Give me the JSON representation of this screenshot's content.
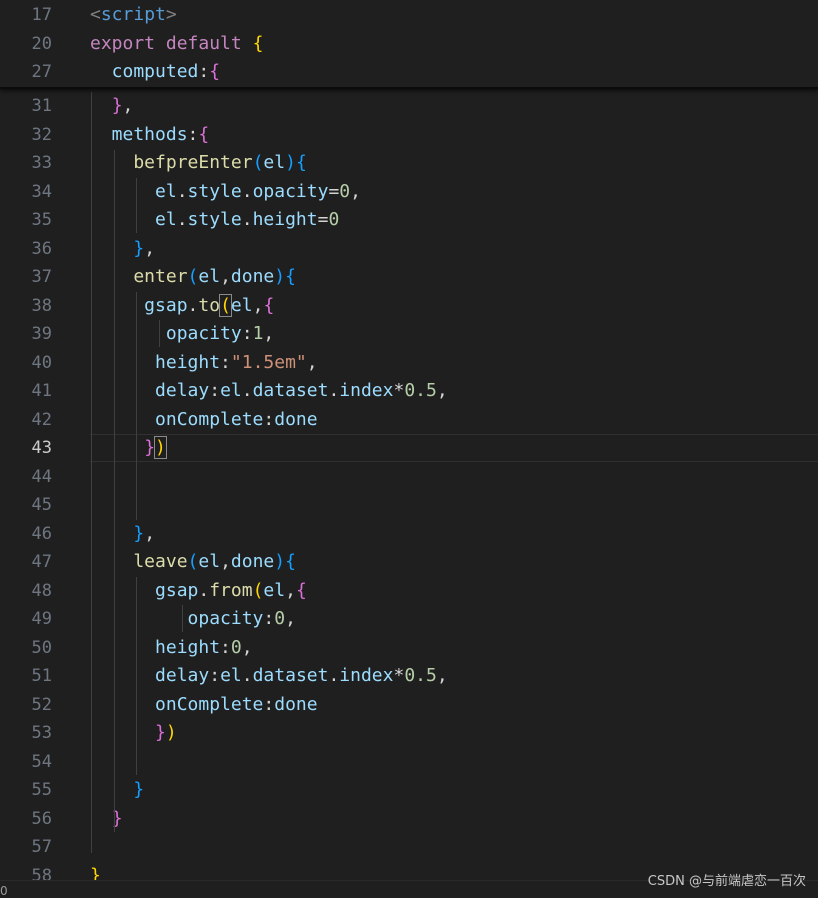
{
  "editor": {
    "sticky_lines": [
      {
        "number": "17",
        "tokens": [
          {
            "t": "<",
            "c": "tag"
          },
          {
            "t": "script",
            "c": "tagname"
          },
          {
            "t": ">",
            "c": "tag"
          }
        ]
      },
      {
        "number": "20",
        "tokens": [
          {
            "t": "export",
            "c": "kw"
          },
          {
            "t": " ",
            "c": "plain"
          },
          {
            "t": "default",
            "c": "kw"
          },
          {
            "t": " ",
            "c": "plain"
          },
          {
            "t": "{",
            "c": "b1"
          }
        ]
      },
      {
        "number": "27",
        "tokens": [
          {
            "t": "  computed",
            "c": "prop"
          },
          {
            "t": ":",
            "c": "plain"
          },
          {
            "t": "{",
            "c": "b2"
          }
        ]
      }
    ],
    "lines": [
      {
        "number": "31",
        "tokens": [
          {
            "t": "  ",
            "c": "plain"
          },
          {
            "t": "}",
            "c": "b2"
          },
          {
            "t": ",",
            "c": "plain"
          }
        ]
      },
      {
        "number": "32",
        "tokens": [
          {
            "t": "  methods",
            "c": "prop"
          },
          {
            "t": ":",
            "c": "plain"
          },
          {
            "t": "{",
            "c": "b2"
          }
        ]
      },
      {
        "number": "33",
        "tokens": [
          {
            "t": "    befpreEnter",
            "c": "fn"
          },
          {
            "t": "(",
            "c": "b3"
          },
          {
            "t": "el",
            "c": "prop"
          },
          {
            "t": ")",
            "c": "b3"
          },
          {
            "t": "{",
            "c": "b3"
          }
        ]
      },
      {
        "number": "34",
        "tokens": [
          {
            "t": "      el",
            "c": "prop"
          },
          {
            "t": ".",
            "c": "plain"
          },
          {
            "t": "style",
            "c": "prop"
          },
          {
            "t": ".",
            "c": "plain"
          },
          {
            "t": "opacity",
            "c": "prop"
          },
          {
            "t": "=",
            "c": "plain"
          },
          {
            "t": "0",
            "c": "num"
          },
          {
            "t": ",",
            "c": "plain"
          }
        ]
      },
      {
        "number": "35",
        "tokens": [
          {
            "t": "      el",
            "c": "prop"
          },
          {
            "t": ".",
            "c": "plain"
          },
          {
            "t": "style",
            "c": "prop"
          },
          {
            "t": ".",
            "c": "plain"
          },
          {
            "t": "height",
            "c": "prop"
          },
          {
            "t": "=",
            "c": "plain"
          },
          {
            "t": "0",
            "c": "num"
          }
        ]
      },
      {
        "number": "36",
        "tokens": [
          {
            "t": "    ",
            "c": "plain"
          },
          {
            "t": "}",
            "c": "b3"
          },
          {
            "t": ",",
            "c": "plain"
          }
        ]
      },
      {
        "number": "37",
        "tokens": [
          {
            "t": "    enter",
            "c": "fn"
          },
          {
            "t": "(",
            "c": "b3"
          },
          {
            "t": "el",
            "c": "prop"
          },
          {
            "t": ",",
            "c": "plain"
          },
          {
            "t": "done",
            "c": "prop"
          },
          {
            "t": ")",
            "c": "b3"
          },
          {
            "t": "{",
            "c": "b3"
          }
        ]
      },
      {
        "number": "38",
        "tokens": [
          {
            "t": "     gsap",
            "c": "prop"
          },
          {
            "t": ".",
            "c": "plain"
          },
          {
            "t": "to",
            "c": "fn"
          },
          {
            "t": "(",
            "c": "b1 bm"
          },
          {
            "t": "el",
            "c": "prop"
          },
          {
            "t": ",",
            "c": "plain"
          },
          {
            "t": "{",
            "c": "b2"
          }
        ]
      },
      {
        "number": "39",
        "tokens": [
          {
            "t": "       opacity",
            "c": "prop"
          },
          {
            "t": ":",
            "c": "plain"
          },
          {
            "t": "1",
            "c": "num"
          },
          {
            "t": ",",
            "c": "plain"
          }
        ]
      },
      {
        "number": "40",
        "tokens": [
          {
            "t": "      height",
            "c": "prop"
          },
          {
            "t": ":",
            "c": "plain"
          },
          {
            "t": "\"1.5em\"",
            "c": "str"
          },
          {
            "t": ",",
            "c": "plain"
          }
        ]
      },
      {
        "number": "41",
        "tokens": [
          {
            "t": "      delay",
            "c": "prop"
          },
          {
            "t": ":",
            "c": "plain"
          },
          {
            "t": "el",
            "c": "prop"
          },
          {
            "t": ".",
            "c": "plain"
          },
          {
            "t": "dataset",
            "c": "prop"
          },
          {
            "t": ".",
            "c": "plain"
          },
          {
            "t": "index",
            "c": "prop"
          },
          {
            "t": "*",
            "c": "plain"
          },
          {
            "t": "0.5",
            "c": "num"
          },
          {
            "t": ",",
            "c": "plain"
          }
        ]
      },
      {
        "number": "42",
        "tokens": [
          {
            "t": "      onComplete",
            "c": "prop"
          },
          {
            "t": ":",
            "c": "plain"
          },
          {
            "t": "done",
            "c": "prop"
          }
        ]
      },
      {
        "number": "43",
        "active": true,
        "tokens": [
          {
            "t": "     ",
            "c": "plain"
          },
          {
            "t": "}",
            "c": "b2"
          },
          {
            "t": ")",
            "c": "b1 bm"
          }
        ]
      },
      {
        "number": "44",
        "tokens": []
      },
      {
        "number": "45",
        "tokens": []
      },
      {
        "number": "46",
        "tokens": [
          {
            "t": "    ",
            "c": "plain"
          },
          {
            "t": "}",
            "c": "b3"
          },
          {
            "t": ",",
            "c": "plain"
          }
        ]
      },
      {
        "number": "47",
        "tokens": [
          {
            "t": "    leave",
            "c": "fn"
          },
          {
            "t": "(",
            "c": "b3"
          },
          {
            "t": "el",
            "c": "prop"
          },
          {
            "t": ",",
            "c": "plain"
          },
          {
            "t": "done",
            "c": "prop"
          },
          {
            "t": ")",
            "c": "b3"
          },
          {
            "t": "{",
            "c": "b3"
          }
        ]
      },
      {
        "number": "48",
        "tokens": [
          {
            "t": "      gsap",
            "c": "prop"
          },
          {
            "t": ".",
            "c": "plain"
          },
          {
            "t": "from",
            "c": "fn"
          },
          {
            "t": "(",
            "c": "b1"
          },
          {
            "t": "el",
            "c": "prop"
          },
          {
            "t": ",",
            "c": "plain"
          },
          {
            "t": "{",
            "c": "b2"
          }
        ]
      },
      {
        "number": "49",
        "tokens": [
          {
            "t": "         opacity",
            "c": "prop"
          },
          {
            "t": ":",
            "c": "plain"
          },
          {
            "t": "0",
            "c": "num"
          },
          {
            "t": ",",
            "c": "plain"
          }
        ]
      },
      {
        "number": "50",
        "tokens": [
          {
            "t": "      height",
            "c": "prop"
          },
          {
            "t": ":",
            "c": "plain"
          },
          {
            "t": "0",
            "c": "num"
          },
          {
            "t": ",",
            "c": "plain"
          }
        ]
      },
      {
        "number": "51",
        "tokens": [
          {
            "t": "      delay",
            "c": "prop"
          },
          {
            "t": ":",
            "c": "plain"
          },
          {
            "t": "el",
            "c": "prop"
          },
          {
            "t": ".",
            "c": "plain"
          },
          {
            "t": "dataset",
            "c": "prop"
          },
          {
            "t": ".",
            "c": "plain"
          },
          {
            "t": "index",
            "c": "prop"
          },
          {
            "t": "*",
            "c": "plain"
          },
          {
            "t": "0.5",
            "c": "num"
          },
          {
            "t": ",",
            "c": "plain"
          }
        ]
      },
      {
        "number": "52",
        "tokens": [
          {
            "t": "      onComplete",
            "c": "prop"
          },
          {
            "t": ":",
            "c": "plain"
          },
          {
            "t": "done",
            "c": "prop"
          }
        ]
      },
      {
        "number": "53",
        "tokens": [
          {
            "t": "      ",
            "c": "plain"
          },
          {
            "t": "}",
            "c": "b2"
          },
          {
            "t": ")",
            "c": "b1"
          }
        ]
      },
      {
        "number": "54",
        "tokens": []
      },
      {
        "number": "55",
        "tokens": [
          {
            "t": "    ",
            "c": "plain"
          },
          {
            "t": "}",
            "c": "b3"
          }
        ]
      },
      {
        "number": "56",
        "tokens": [
          {
            "t": "  ",
            "c": "plain"
          },
          {
            "t": "}",
            "c": "b2"
          }
        ]
      },
      {
        "number": "57",
        "tokens": []
      },
      {
        "number": "58",
        "tokens": [
          {
            "t": "}",
            "c": "b1"
          }
        ]
      }
    ]
  },
  "watermark": "CSDN @与前端虐恋一百次",
  "corner_text": "0",
  "colors": {
    "background": "#1f1f1f",
    "line_number": "#6e7681",
    "line_number_active": "#cccccc",
    "keyword": "#c586c0",
    "property": "#9cdcfe",
    "function": "#dcdcaa",
    "number": "#b5cea8",
    "string": "#ce9178",
    "bracket_gold": "#ffd700",
    "bracket_pink": "#da70d6",
    "bracket_blue": "#179fff"
  }
}
